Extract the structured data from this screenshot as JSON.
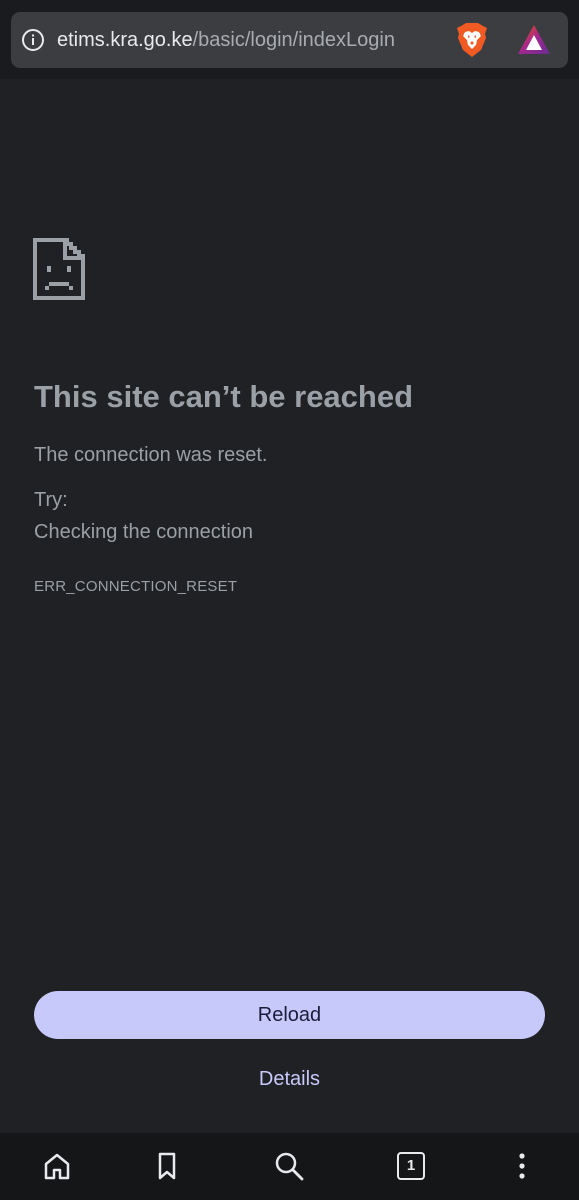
{
  "address_bar": {
    "url_host": "etims.kra.go.ke",
    "url_path": "/basic/login/indexLogin",
    "info_icon": "info-circle-icon",
    "brave_icon": "brave-shields-lion-icon",
    "rewards_icon": "brave-rewards-triangle-icon"
  },
  "error": {
    "icon": "sad-document-icon",
    "title": "This site can’t be reached",
    "description": "The connection was reset.",
    "try_label": "Try:",
    "suggestions": [
      "Checking the connection"
    ],
    "code": "ERR_CONNECTION_RESET"
  },
  "actions": {
    "reload_label": "Reload",
    "details_label": "Details"
  },
  "bottom_toolbar": {
    "home_icon": "home-icon",
    "bookmark_icon": "bookmark-icon",
    "search_icon": "search-icon",
    "tab_count": "1",
    "menu_icon": "more-vertical-icon"
  },
  "colors": {
    "background": "#202124",
    "omnibox": "#3c3d41",
    "text_muted": "#9aa0a6",
    "accent": "#c8c9fb"
  }
}
